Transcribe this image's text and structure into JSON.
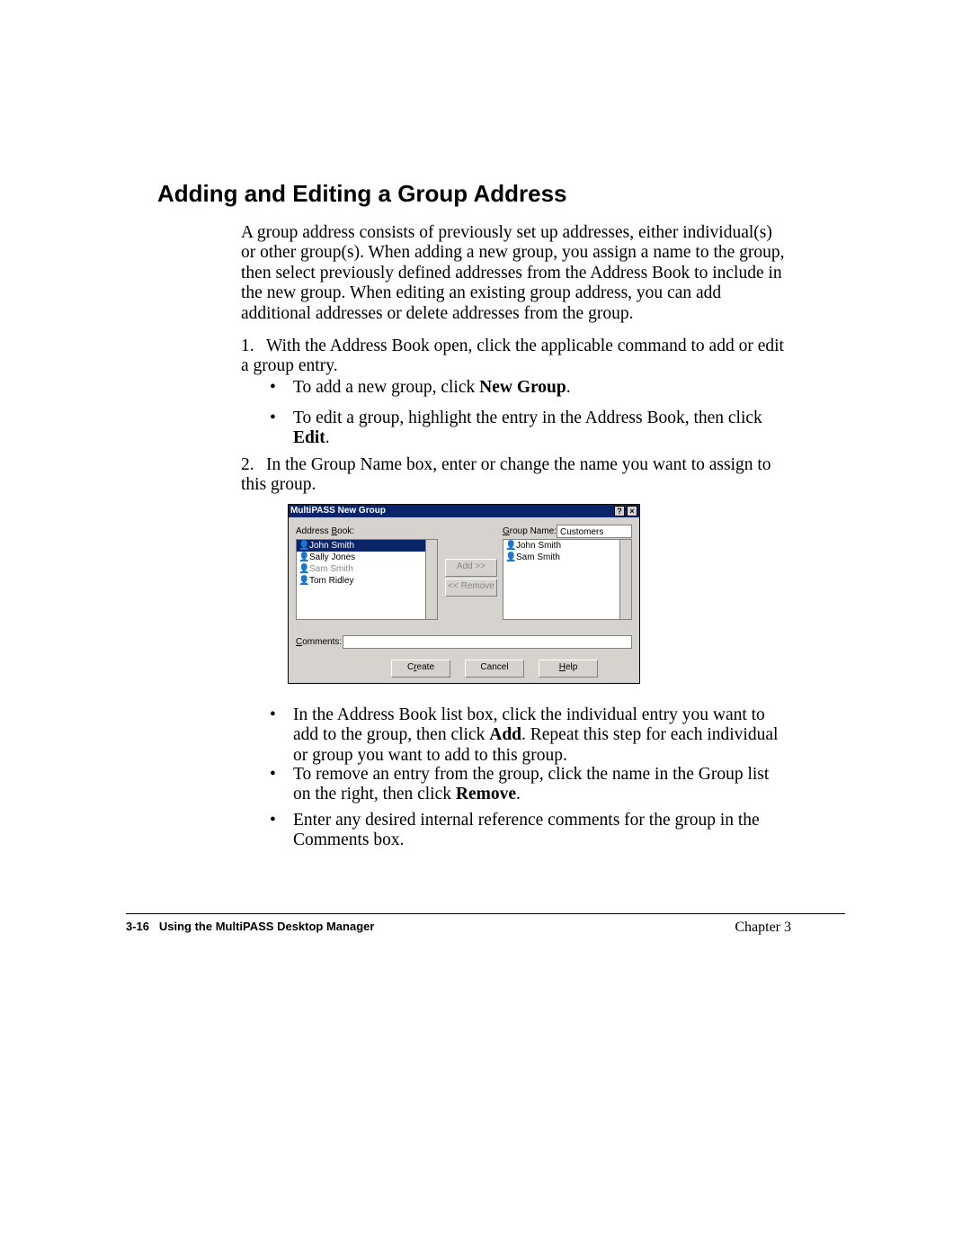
{
  "heading": "Adding and Editing a Group Address",
  "intro": "A group address consists of previously set up addresses, either individual(s) or other group(s). When adding a new group, you assign a name to the group, then select previously defined addresses from the Address Book to include in the new group. When editing an existing group address, you can add additional addresses or delete addresses from the group.",
  "steps": {
    "n1": "1.",
    "s1": "With the Address Book open, click the applicable command to add or edit a group entry.",
    "n2": "2.",
    "s2": "In the Group Name box, enter or change the name you want to assign to this group.",
    "b1a": "To add a new group, click ",
    "b1b_bold": "New Group",
    "b1c": ".",
    "b2a": "To edit a group, highlight the entry in the Address Book, then click ",
    "b2b_bold": "Edit",
    "b2c": ".",
    "b3a": "In the Address Book list box, click the individual entry you want to add to the group, then click ",
    "b3b_bold": "Add",
    "b3c": ". Repeat this step for each individual or group you want to add to this group.",
    "b4a": "To remove an entry from the group, click the name in the Group list on the right, then click ",
    "b4b_bold": "Remove",
    "b4c": ".",
    "b5": "Enter any desired internal reference comments for the group in the Comments box."
  },
  "dialog": {
    "title": "MultiPASS New Group",
    "help": "?",
    "close": "×",
    "address_book_label": "Address Book:",
    "group_name_label": "Group Name:",
    "group_name_value": "Customers",
    "add_btn": "Add >>",
    "remove_btn": "<< Remove",
    "comments_label": "Comments:",
    "create_btn": "Create",
    "cancel_btn": "Cancel",
    "help_btn": "Help",
    "left_items": [
      "John Smith",
      "Sally Jones",
      "Sam Smith",
      "Tom Ridley"
    ],
    "right_items": [
      "John Smith",
      "Sam Smith"
    ]
  },
  "footer": {
    "page": "3-16",
    "title": "Using the MultiPASS Desktop Manager",
    "chapter": "Chapter 3"
  }
}
